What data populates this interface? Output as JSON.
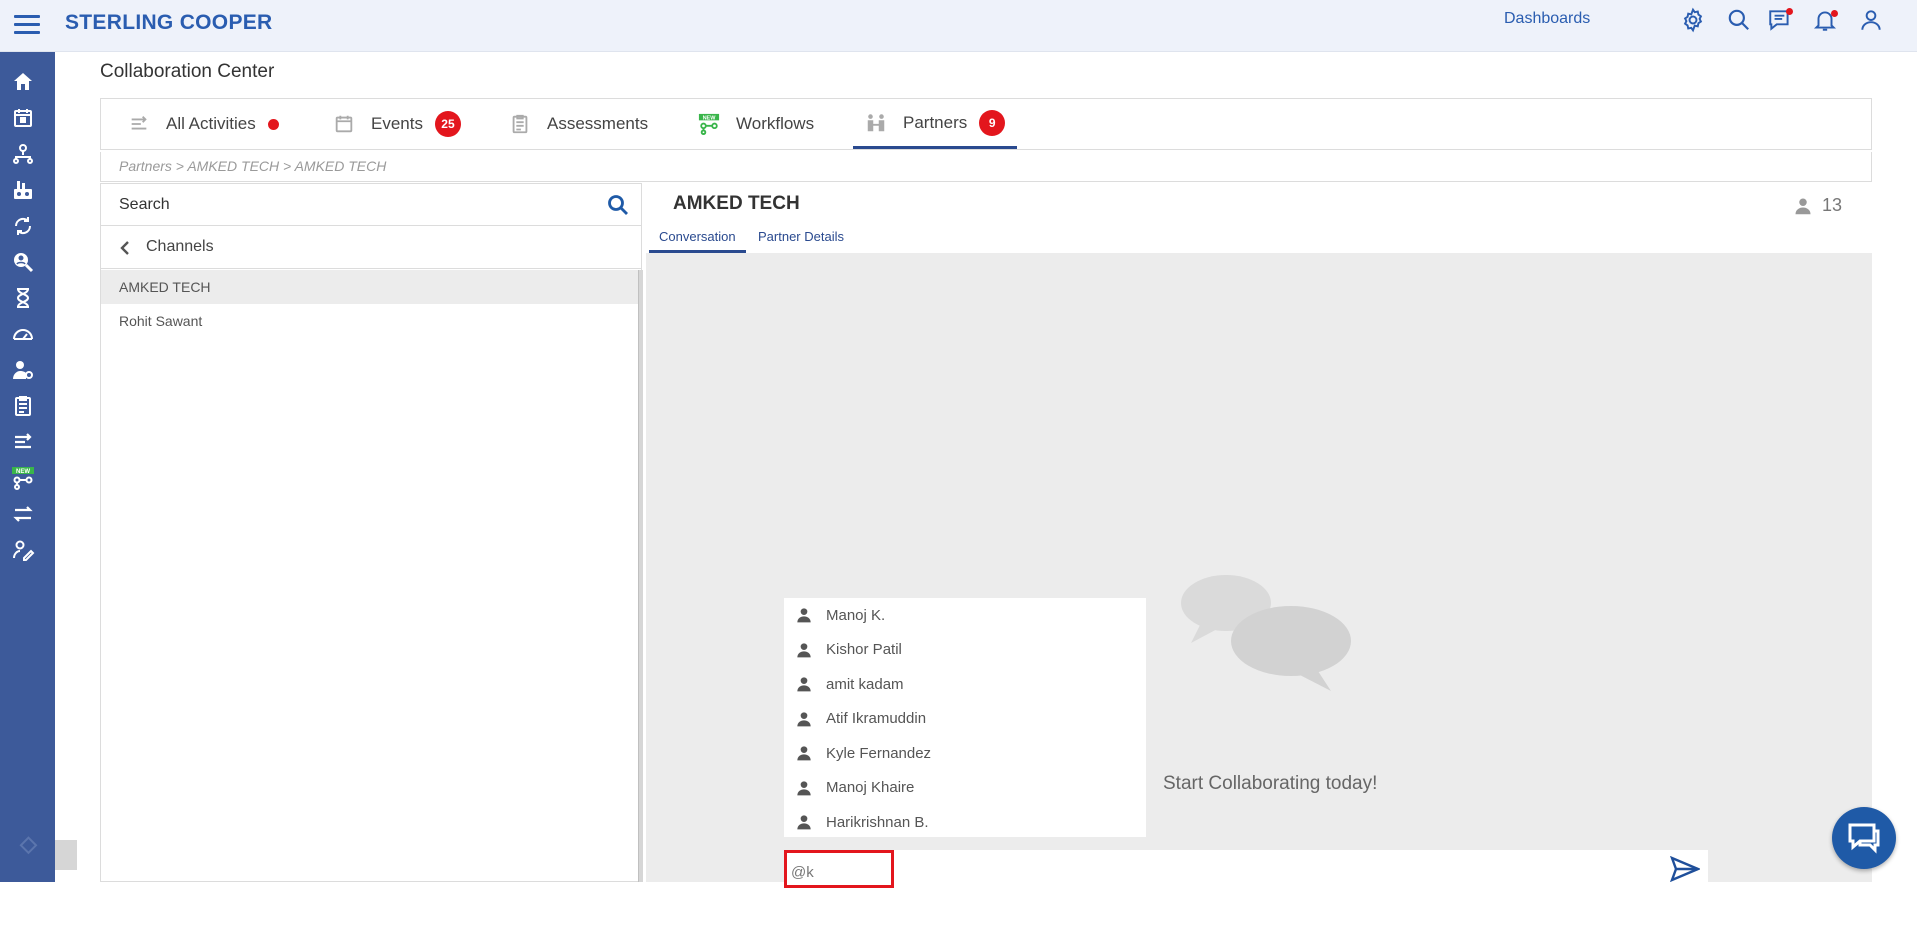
{
  "header": {
    "brand": "STERLING COOPER",
    "dashboards_label": "Dashboards",
    "icons": [
      "settings-icon",
      "search-icon",
      "messages-icon",
      "notifications-icon",
      "user-icon"
    ]
  },
  "sidebar": {
    "icons": [
      "home-icon",
      "calendar-icon",
      "org-chart-icon",
      "vendor-icon",
      "cycle-icon",
      "search-person-icon",
      "hourglass-icon",
      "gauge-icon",
      "user-settings-icon",
      "clipboard-icon",
      "list-transfer-icon",
      "workflow-new-icon",
      "swap-arrows-icon",
      "pen-user-icon"
    ]
  },
  "page": {
    "title": "Collaboration Center"
  },
  "tabs": [
    {
      "label": "All Activities",
      "indicator": "dot"
    },
    {
      "label": "Events",
      "badge": "25"
    },
    {
      "label": "Assessments"
    },
    {
      "label": "Workflows",
      "tag": "NEW"
    },
    {
      "label": "Partners",
      "badge": "9",
      "active": true
    }
  ],
  "breadcrumb": "Partners > AMKED TECH > AMKED TECH",
  "channels_panel": {
    "search_placeholder": "Search",
    "channels_label": "Channels",
    "channels": [
      {
        "name": "AMKED TECH",
        "selected": true
      },
      {
        "name": "Rohit Sawant",
        "selected": false
      }
    ]
  },
  "conversation": {
    "title": "AMKED TECH",
    "member_count": "13",
    "tabs": [
      {
        "label": "Conversation",
        "active": true
      },
      {
        "label": "Partner Details",
        "active": false
      }
    ],
    "mention_suggestions": [
      "Manoj K.",
      "Kishor Patil",
      "amit kadam",
      "Atif Ikramuddin",
      "Kyle Fernandez",
      "Manoj Khaire",
      "Harikrishnan B."
    ],
    "empty_state_text": "Start Collaborating today!",
    "compose_value": "@k"
  },
  "colors": {
    "brand_blue": "#2a5db0",
    "sidebar_bg": "#3d5a9a",
    "badge_red": "#e3161d",
    "active_tab": "#2a4a8f"
  }
}
